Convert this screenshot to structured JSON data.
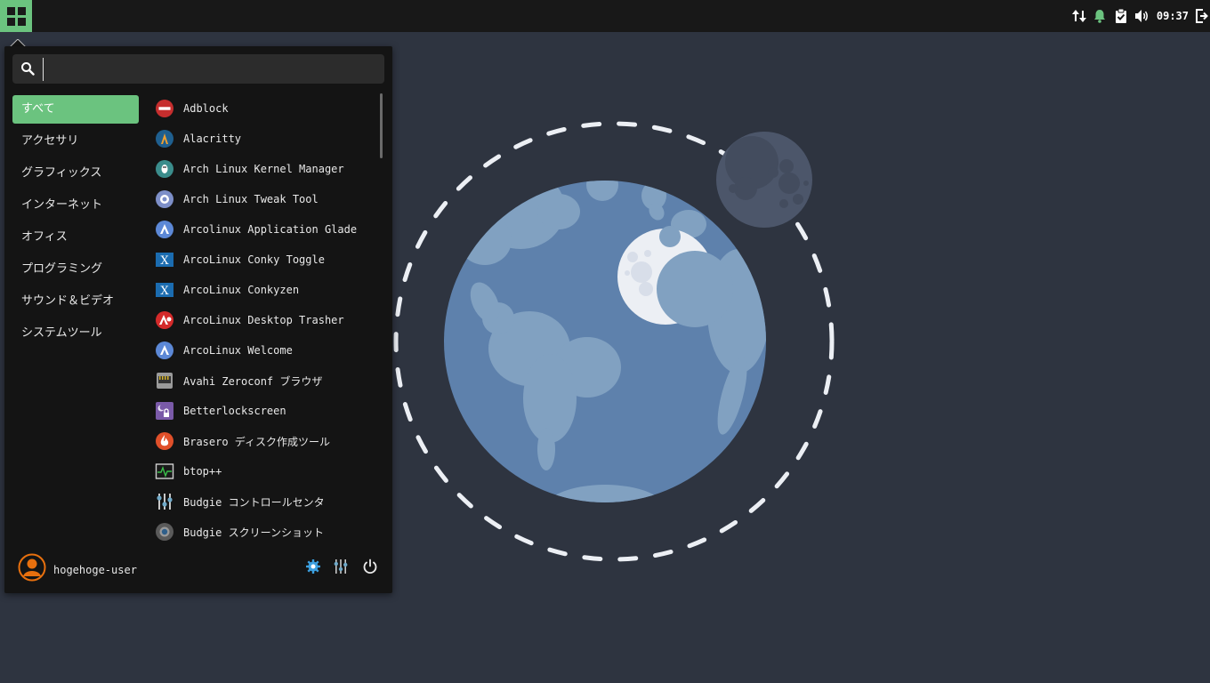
{
  "panel": {
    "clock": "09:37",
    "tray_icons": [
      "network-transfer-icon",
      "notification-bell-icon",
      "clipboard-icon",
      "volume-icon",
      "logout-icon"
    ]
  },
  "menu": {
    "search": {
      "value": "",
      "placeholder": ""
    },
    "categories": [
      {
        "label": "すべて",
        "active": true
      },
      {
        "label": "アクセサリ"
      },
      {
        "label": "グラフィックス"
      },
      {
        "label": "インターネット"
      },
      {
        "label": "オフィス"
      },
      {
        "label": "プログラミング"
      },
      {
        "label": "サウンド＆ビデオ"
      },
      {
        "label": "システムツール"
      }
    ],
    "apps": [
      {
        "label": "Adblock",
        "icon": "adblock-icon"
      },
      {
        "label": "Alacritty",
        "icon": "alacritty-icon"
      },
      {
        "label": "Arch Linux Kernel Manager",
        "icon": "kernel-manager-icon"
      },
      {
        "label": "Arch Linux Tweak Tool",
        "icon": "tweak-tool-icon"
      },
      {
        "label": "Arcolinux Application Glade",
        "icon": "arcolinux-icon"
      },
      {
        "label": "ArcoLinux Conky Toggle",
        "icon": "conky-icon"
      },
      {
        "label": "ArcoLinux Conkyzen",
        "icon": "conky-icon"
      },
      {
        "label": "ArcoLinux Desktop Trasher",
        "icon": "desktop-trasher-icon"
      },
      {
        "label": "ArcoLinux Welcome",
        "icon": "arcolinux-icon"
      },
      {
        "label": "Avahi Zeroconf ブラウザ",
        "icon": "network-card-icon"
      },
      {
        "label": "Betterlockscreen",
        "icon": "lockscreen-icon"
      },
      {
        "label": "Brasero ディスク作成ツール",
        "icon": "brasero-icon"
      },
      {
        "label": "btop++",
        "icon": "system-monitor-icon"
      },
      {
        "label": "Budgie コントロールセンタ",
        "icon": "control-center-icon"
      },
      {
        "label": "Budgie スクリーンショット",
        "icon": "screenshot-icon"
      }
    ],
    "user": "hogehoge-user",
    "footer_actions": [
      "settings-icon",
      "mixer-icon",
      "power-icon"
    ]
  },
  "colors": {
    "accent": "#6bc37f",
    "desktop": "#2e3440",
    "panel": "#181818",
    "menu_bg": "#141414",
    "earth": "#5e81ac",
    "land": "#81a1c1",
    "moon": "#4c566a"
  }
}
